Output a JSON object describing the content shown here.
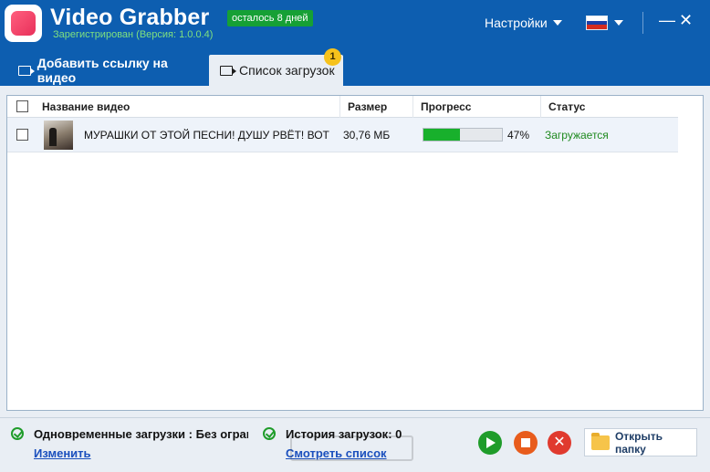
{
  "app": {
    "title": "Video Grabber",
    "trial_badge": "осталось 8 дней",
    "version_text": "Зарегистрирован (Версия: 1.0.0.4)",
    "settings_label": "Настройки",
    "language_flag": "flag-russia-icon",
    "minimize_label": "—",
    "close_label": "✕"
  },
  "tabs": [
    {
      "label": "Добавить ссылку на видео",
      "icon": "download-link-icon",
      "active": false
    },
    {
      "label": "Список загрузок",
      "icon": "download-list-icon",
      "active": true,
      "badge": "1"
    }
  ],
  "table": {
    "columns": [
      "Название видео",
      "Размер",
      "Прогресс",
      "Статус"
    ],
    "rows": [
      {
        "title": "МУРАШКИ ОТ ЭТОЙ ПЕСНИ! ДУШУ РВЁТ! ВОТ",
        "size": "30,76 МБ",
        "progress": 0.47,
        "progress_label": "47%",
        "status": "Загружается"
      }
    ]
  },
  "footer": {
    "concurrent_label": "Одновременные загрузки : Без ограничений",
    "concurrent_link": "Изменить",
    "history_label": "История загрузок: 0",
    "history_link": "Смотреть список",
    "open_folder_label": "Открыть папку",
    "cancel_glyph": "✕"
  },
  "colors": {
    "titlebar": "#0d5eb0",
    "accent_green": "#18b02c",
    "trial_badge": "#16a035",
    "badge_yellow": "#f6c21c",
    "stop_orange": "#e85c1c",
    "cancel_red": "#e03a2e",
    "link_blue": "#1a4fbd"
  }
}
